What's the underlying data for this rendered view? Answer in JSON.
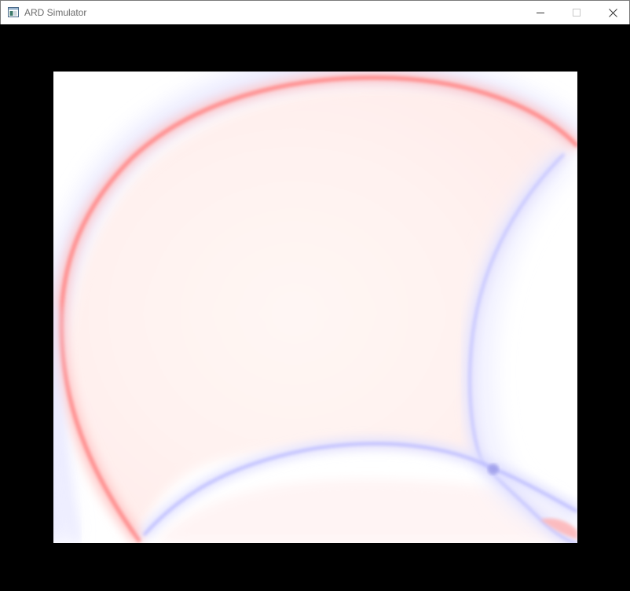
{
  "window": {
    "title": "ARD Simulator",
    "icon": "app-window-icon",
    "controls": {
      "minimize": "minimize-icon",
      "maximize": "maximize-icon",
      "close": "close-icon"
    }
  },
  "simulation": {
    "description_colors": {
      "positive": "#ff8a8a",
      "negative": "#b8b8ff",
      "background": "#ffffff",
      "frame": "#000000"
    }
  }
}
